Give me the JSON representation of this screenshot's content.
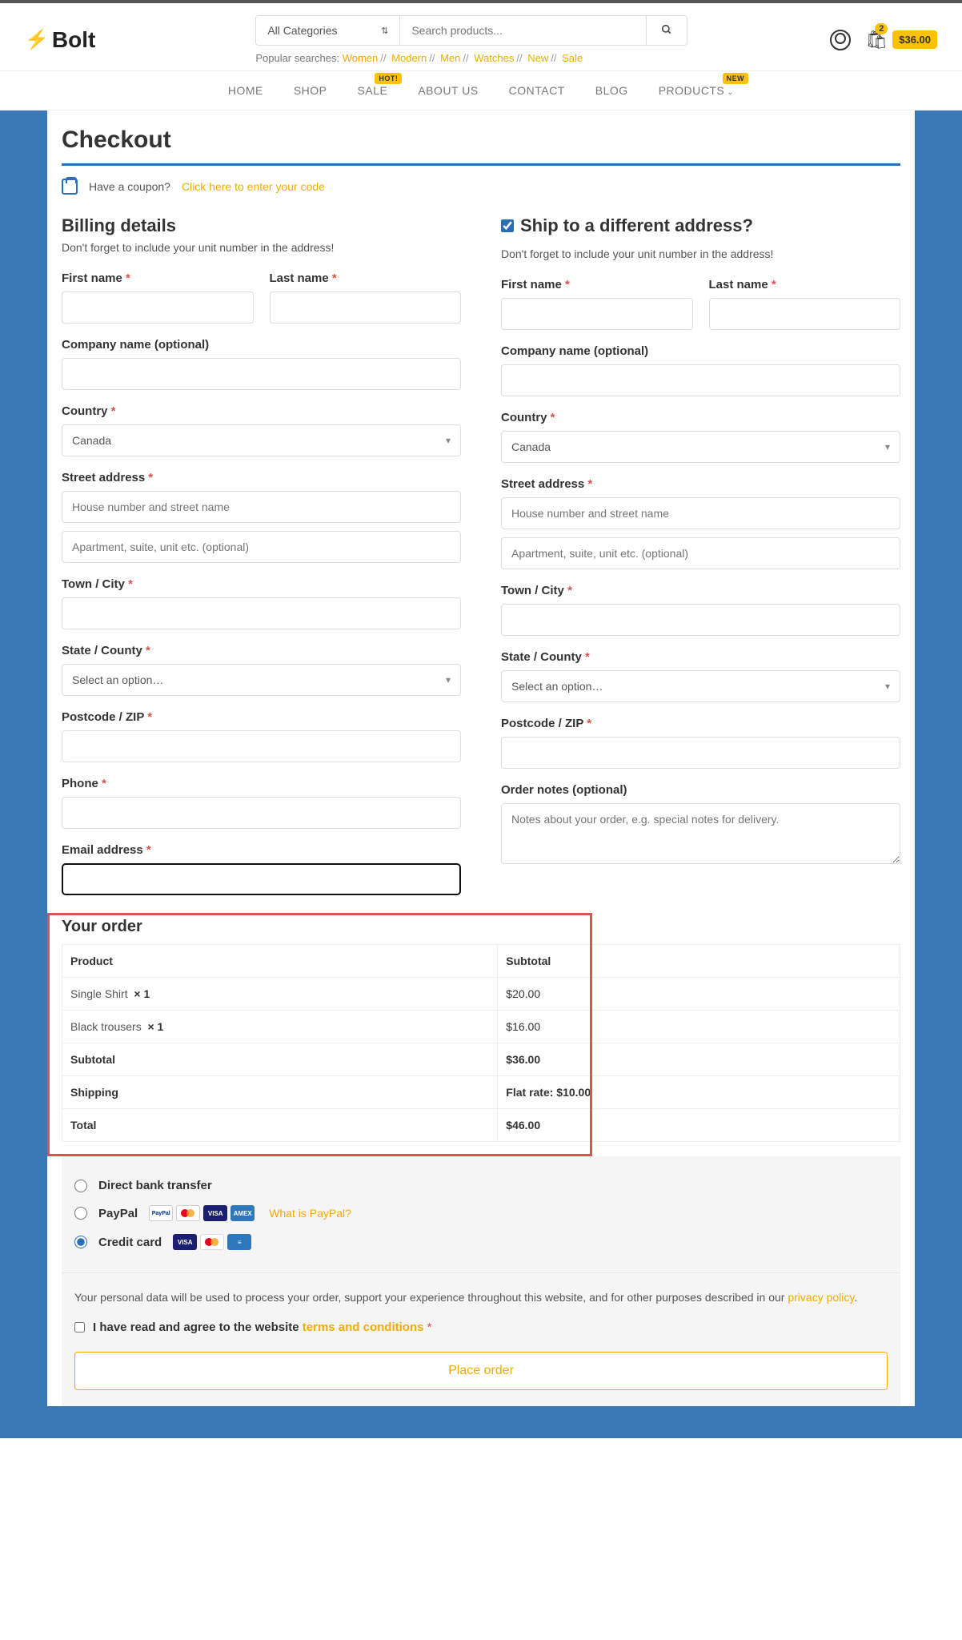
{
  "logo": "Bolt",
  "search": {
    "category": "All Categories",
    "placeholder": "Search products...",
    "popular_label": "Popular searches:",
    "popular": [
      "Women",
      "Modern",
      "Men",
      "Watches",
      "New",
      "Sale"
    ]
  },
  "cart": {
    "count": "2",
    "total": "$36.00"
  },
  "nav": {
    "home": "HOME",
    "shop": "SHOP",
    "sale": "SALE",
    "sale_badge": "HOT!",
    "about": "ABOUT US",
    "contact": "CONTACT",
    "blog": "BLOG",
    "products": "PRODUCTS",
    "products_badge": "NEW"
  },
  "page_title": "Checkout",
  "coupon": {
    "q": "Have a coupon?",
    "link": "Click here to enter your code"
  },
  "billing": {
    "heading": "Billing details",
    "sub": "Don't forget to include your unit number in the address!",
    "first": "First name",
    "last": "Last name",
    "company": "Company name (optional)",
    "country": "Country",
    "country_val": "Canada",
    "street": "Street address",
    "street_ph1": "House number and street name",
    "street_ph2": "Apartment, suite, unit etc. (optional)",
    "city": "Town / City",
    "state": "State / County",
    "state_ph": "Select an option…",
    "zip": "Postcode / ZIP",
    "phone": "Phone",
    "email": "Email address"
  },
  "shipping": {
    "heading": "Ship to a different address?",
    "sub": "Don't forget to include your unit number in the address!",
    "notes": "Order notes (optional)",
    "notes_ph": "Notes about your order, e.g. special notes for delivery."
  },
  "order": {
    "heading": "Your order",
    "col_product": "Product",
    "col_subtotal": "Subtotal",
    "items": [
      {
        "name": "Single Shirt",
        "qty": "× 1",
        "price": "$20.00"
      },
      {
        "name": "Black trousers",
        "qty": "× 1",
        "price": "$16.00"
      }
    ],
    "subtotal_l": "Subtotal",
    "subtotal_v": "$36.00",
    "shipping_l": "Shipping",
    "shipping_v": "Flat rate: $10.00",
    "total_l": "Total",
    "total_v": "$46.00"
  },
  "payment": {
    "bank": "Direct bank transfer",
    "paypal": "PayPal",
    "whatis": "What is PayPal?",
    "cc": "Credit card"
  },
  "privacy": {
    "text": "Your personal data will be used to process your order, support your experience throughout this website, and for other purposes described in our ",
    "link": "privacy policy",
    "agree1": "I have read and agree to the website ",
    "agree2": "terms and conditions",
    "req": "*"
  },
  "place": "Place order"
}
